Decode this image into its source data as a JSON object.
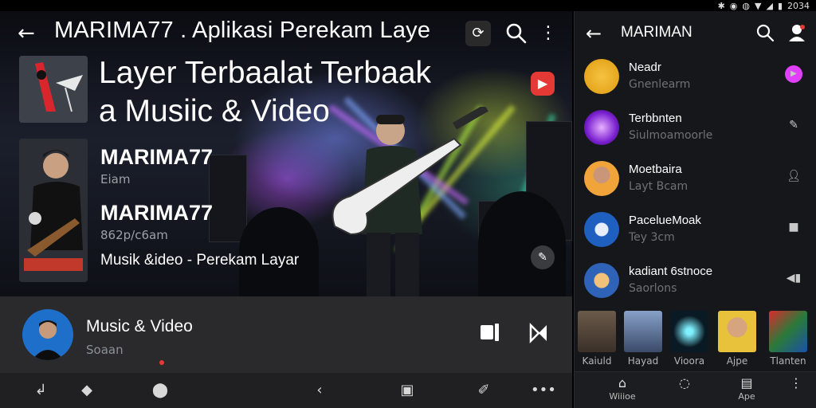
{
  "status_bar": {
    "time": "2034"
  },
  "left": {
    "title": "MARIMA77 . Aplikasi Perekam Laye",
    "heading_line1": "Layer Terbaalat Terbaak",
    "heading_line2": "a Musiic & Video",
    "artists": [
      {
        "name": "MARIMA77",
        "sub": "Eiam"
      },
      {
        "name": "MARIMA77",
        "sub": "862p/c6am"
      }
    ],
    "description": "Musik &ideo  - Perekam Layar",
    "mini_player": {
      "title": "Music & Video",
      "sub": "Soaan"
    }
  },
  "right": {
    "title": "MARIMAN",
    "items": [
      {
        "name": "Neadr",
        "sub": "Gnenlearm",
        "accent": "#e040fb"
      },
      {
        "name": "Terbbnten",
        "sub": "Siulmoamoorle"
      },
      {
        "name": "Moetbaira",
        "sub": "Layt Bcam"
      },
      {
        "name": "PacelueMoak",
        "sub": "Tey 3cm"
      },
      {
        "name": "kadiant 6stnoce",
        "sub": "Saorlons"
      }
    ],
    "tiles": [
      {
        "label": "Kaiuld"
      },
      {
        "label": "Hayad"
      },
      {
        "label": "Vioora"
      },
      {
        "label": "Ajpe"
      },
      {
        "label": "Tlanten"
      }
    ],
    "nav": [
      {
        "label": "Wiiioe"
      },
      {
        "label": ""
      },
      {
        "label": "Ape"
      },
      {
        "label": ""
      }
    ]
  },
  "icons": {
    "back": "back-arrow-icon",
    "search": "search-icon",
    "more": "more-vert-icon",
    "play": "play-icon"
  },
  "colors": {
    "accent_red": "#e53935",
    "accent_pink": "#e040fb"
  }
}
